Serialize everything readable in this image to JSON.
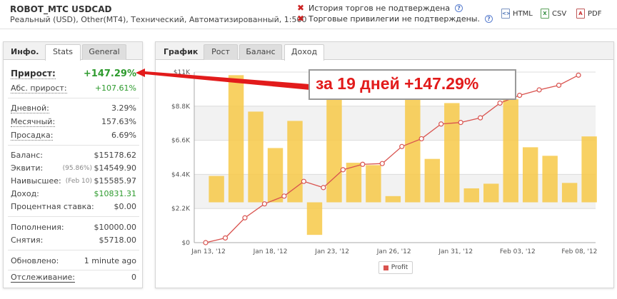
{
  "header": {
    "title": "ROBOT_MTC USDCAD",
    "subtitle": "Реальный (USD), Other(MT4), Технический, Автоматизированный, 1:500",
    "warnings": [
      "История торгов не подтверждена",
      "Торговые привилегии не подтверждены."
    ],
    "exports": [
      {
        "label": "HTML",
        "icon": "html-file-icon"
      },
      {
        "label": "CSV",
        "icon": "csv-file-icon"
      },
      {
        "label": "PDF",
        "icon": "pdf-file-icon"
      }
    ]
  },
  "left_panel": {
    "heading": "Инфо.",
    "tabs": [
      "Stats",
      "General"
    ],
    "active_tab": "Stats",
    "gain": {
      "label": "Прирост:",
      "value": "+147.29%"
    },
    "abs_gain": {
      "label": "Абс. прирост:",
      "value": "+107.61%"
    },
    "daily": {
      "label": "Дневной:",
      "value": "3.29%"
    },
    "monthly": {
      "label": "Месячный:",
      "value": "157.63%"
    },
    "drawdown": {
      "label": "Просадка:",
      "value": "6.69%"
    },
    "balance": {
      "label": "Баланс:",
      "value": "$15178.62"
    },
    "equity": {
      "label": "Эквити:",
      "note": "(95.86%)",
      "value": "$14549.90"
    },
    "highest": {
      "label": "Наивысшее:",
      "note": "(Feb 10)",
      "value": "$15585.97"
    },
    "profit": {
      "label": "Доход:",
      "value": "$10831.31"
    },
    "interest": {
      "label": "Процентная ставка:",
      "value": "$0.00"
    },
    "deposits": {
      "label": "Пополнения:",
      "value": "$10000.00"
    },
    "withdrawals": {
      "label": "Снятия:",
      "value": "$5718.00"
    },
    "updated": {
      "label": "Обновлено:",
      "value": "1 minute ago"
    },
    "tracking": {
      "label": "Отслеживание:",
      "value": "0"
    }
  },
  "right_panel": {
    "heading": "График",
    "tabs": [
      "Рост",
      "Баланс",
      "Доход"
    ],
    "active_tab": "Доход"
  },
  "annotation": {
    "text": "за 19 дней +147.29%",
    "color": "#e21b1b"
  },
  "chart_data": {
    "type": "bar",
    "x_tick_labels": [
      "Jan 13, '12",
      "Jan 18, '12",
      "Jan 23, '12",
      "Jan 26, '12",
      "Jan 31, '12",
      "Feb 03, '12",
      "Feb 08, '12"
    ],
    "y_tick_labels": [
      "$0",
      "$2.2K",
      "$4.4K",
      "$6.6K",
      "$8.8K",
      "$11K"
    ],
    "ylim": [
      0,
      11000
    ],
    "bars": [
      {
        "low": 2600,
        "high": 4300
      },
      {
        "low": 2600,
        "high": 10800
      },
      {
        "low": 2600,
        "high": 8450
      },
      {
        "low": 2600,
        "high": 6100
      },
      {
        "low": 2600,
        "high": 7850
      },
      {
        "low": 500,
        "high": 2600
      },
      {
        "low": 2600,
        "high": 9800
      },
      {
        "low": 2600,
        "high": 5150
      },
      {
        "low": 2600,
        "high": 5000
      },
      {
        "low": 2600,
        "high": 3000
      },
      {
        "low": 2600,
        "high": 9850
      },
      {
        "low": 2600,
        "high": 5400
      },
      {
        "low": 2600,
        "high": 9000
      },
      {
        "low": 2600,
        "high": 3500
      },
      {
        "low": 2600,
        "high": 3800
      },
      {
        "low": 2600,
        "high": 9250
      },
      {
        "low": 2600,
        "high": 6150
      },
      {
        "low": 2600,
        "high": 5600
      },
      {
        "low": 2600,
        "high": 3850
      },
      {
        "low": 2600,
        "high": 6850
      }
    ],
    "series": [
      {
        "name": "Profit",
        "color": "#d9534f",
        "values": [
          0,
          300,
          1600,
          2500,
          3000,
          3950,
          3550,
          4700,
          5050,
          5100,
          6200,
          6700,
          7650,
          7750,
          8050,
          9000,
          9500,
          9850,
          10150,
          10800
        ]
      }
    ],
    "bar_color": "#f7c948",
    "grid": true
  }
}
